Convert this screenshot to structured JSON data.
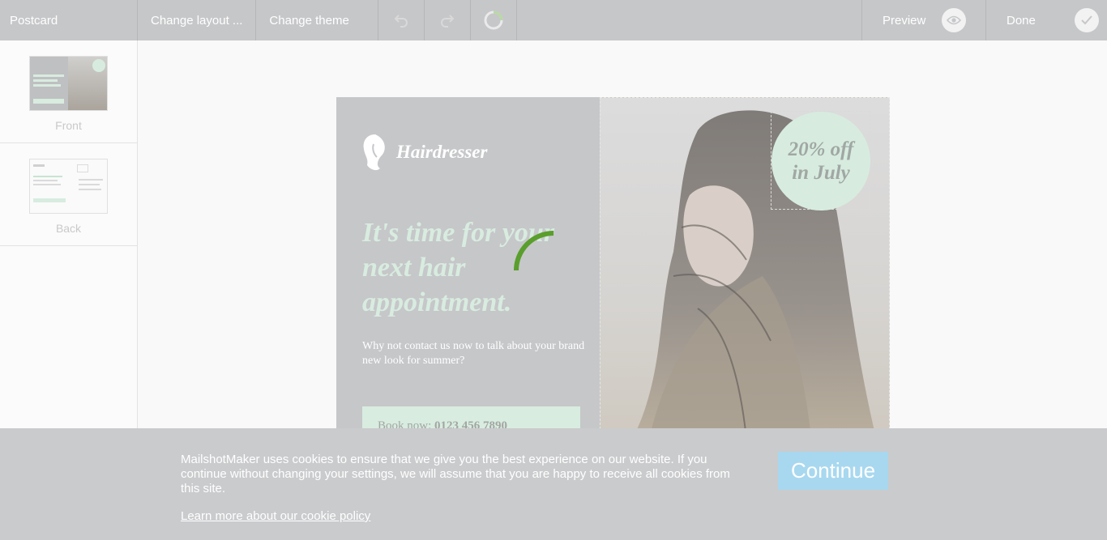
{
  "toolbar": {
    "title": "Postcard",
    "change_layout": "Change layout ...",
    "change_theme": "Change theme",
    "preview": "Preview",
    "done": "Done",
    "undo_icon": "undo-icon",
    "redo_icon": "redo-icon"
  },
  "sidebar": {
    "pages": [
      {
        "label": "Front"
      },
      {
        "label": "Back"
      }
    ]
  },
  "postcard": {
    "logo_text": "Hairdresser",
    "headline": "It's time for your next hair appointment.",
    "subtext": "Why not contact us now to talk about your brand new look for summer?",
    "book_label": "Book now: ",
    "book_phone": "0123 456 7890",
    "offer_line1": "20% off",
    "offer_line2": "in July"
  },
  "cookie": {
    "message": "MailshotMaker uses cookies to ensure that we give you the best experience on our website. If you continue without changing your settings, we will assume that you are happy to receive all cookies from this site.",
    "link": "Learn more about our cookie policy",
    "continue": "Continue"
  },
  "colors": {
    "toolbar_bg": "#c6c7c9",
    "accent_green": "#5a9e2c",
    "mint": "#d7ecdf",
    "continue_bg": "#a8d8ef"
  }
}
